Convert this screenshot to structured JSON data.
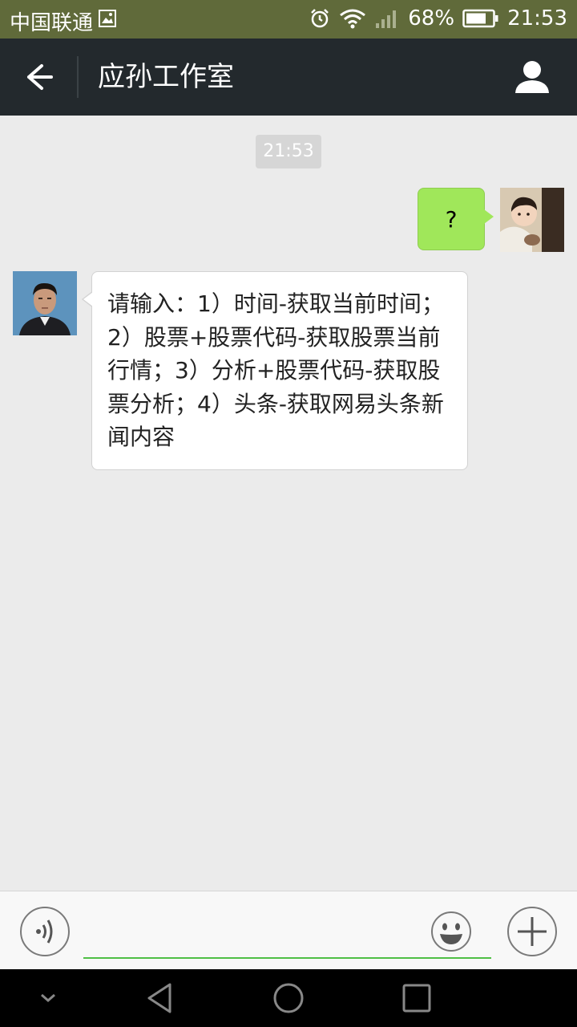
{
  "status_bar": {
    "carrier": "中国联通",
    "battery_percent": "68%",
    "time": "21:53"
  },
  "header": {
    "title": "应孙工作室"
  },
  "chat": {
    "timestamp": "21:53",
    "messages": [
      {
        "side": "right",
        "text": "?"
      },
      {
        "side": "left",
        "text": "请输入：1）时间-获取当前时间；2）股票+股票代码-获取股票当前行情；3）分析+股票代码-获取股票分析；4）头条-获取网易头条新闻内容"
      }
    ]
  },
  "input_bar": {
    "value": "",
    "placeholder": ""
  },
  "colors": {
    "status_bar_bg": "#606a3a",
    "header_bg": "#23292d",
    "my_bubble": "#a0e75a",
    "input_underline": "#4fbf46"
  }
}
